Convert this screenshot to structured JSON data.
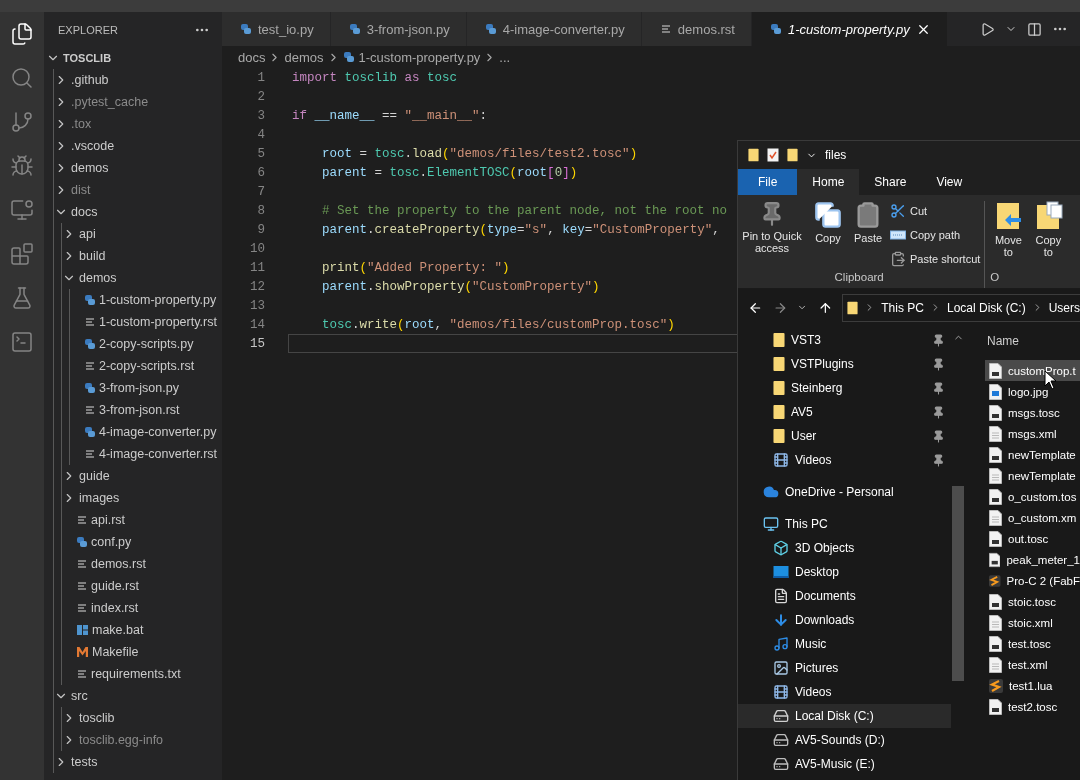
{
  "activity_bar": [
    {
      "kind": "files",
      "selected": true
    },
    {
      "kind": "search",
      "selected": false
    },
    {
      "kind": "source-control",
      "selected": false
    },
    {
      "kind": "debug",
      "selected": false
    },
    {
      "kind": "remote",
      "selected": false
    },
    {
      "kind": "extensions",
      "selected": false
    },
    {
      "kind": "testing",
      "selected": false
    },
    {
      "kind": "terminal",
      "selected": false
    }
  ],
  "sidebar": {
    "title": "EXPLORER",
    "root": {
      "label": "TOSCLIB",
      "kind": "folder",
      "expanded": true,
      "children": [
        {
          "label": ".github",
          "kind": "folder",
          "expanded": false,
          "dimmed": false
        },
        {
          "label": ".pytest_cache",
          "kind": "folder",
          "expanded": false,
          "dimmed": true
        },
        {
          "label": ".tox",
          "kind": "folder",
          "expanded": false,
          "dimmed": true
        },
        {
          "label": ".vscode",
          "kind": "folder",
          "expanded": false,
          "dimmed": false
        },
        {
          "label": "demos",
          "kind": "folder",
          "expanded": false,
          "dimmed": false
        },
        {
          "label": "dist",
          "kind": "folder",
          "expanded": false,
          "dimmed": true
        },
        {
          "label": "docs",
          "kind": "folder",
          "expanded": true,
          "dimmed": false,
          "children": [
            {
              "label": "api",
              "kind": "folder",
              "expanded": false,
              "dimmed": false
            },
            {
              "label": "build",
              "kind": "folder",
              "expanded": false,
              "dimmed": false
            },
            {
              "label": "demos",
              "kind": "folder",
              "expanded": true,
              "dimmed": false,
              "children": [
                {
                  "label": "1-custom-property.py",
                  "kind": "py",
                  "dimmed": false
                },
                {
                  "label": "1-custom-property.rst",
                  "kind": "rst",
                  "dimmed": false
                },
                {
                  "label": "2-copy-scripts.py",
                  "kind": "py",
                  "dimmed": false
                },
                {
                  "label": "2-copy-scripts.rst",
                  "kind": "rst",
                  "dimmed": false
                },
                {
                  "label": "3-from-json.py",
                  "kind": "py",
                  "dimmed": false
                },
                {
                  "label": "3-from-json.rst",
                  "kind": "rst",
                  "dimmed": false
                },
                {
                  "label": "4-image-converter.py",
                  "kind": "py",
                  "dimmed": false
                },
                {
                  "label": "4-image-converter.rst",
                  "kind": "rst",
                  "dimmed": false
                }
              ]
            },
            {
              "label": "guide",
              "kind": "folder",
              "expanded": false,
              "dimmed": false
            },
            {
              "label": "images",
              "kind": "folder",
              "expanded": false,
              "dimmed": false
            },
            {
              "label": "api.rst",
              "kind": "rst",
              "dimmed": false
            },
            {
              "label": "conf.py",
              "kind": "py",
              "dimmed": false
            },
            {
              "label": "demos.rst",
              "kind": "rst",
              "dimmed": false
            },
            {
              "label": "guide.rst",
              "kind": "rst",
              "dimmed": false
            },
            {
              "label": "index.rst",
              "kind": "rst",
              "dimmed": false
            },
            {
              "label": "make.bat",
              "kind": "bat",
              "dimmed": false
            },
            {
              "label": "Makefile",
              "kind": "make",
              "dimmed": false
            },
            {
              "label": "requirements.txt",
              "kind": "rst",
              "dimmed": false
            }
          ]
        },
        {
          "label": "src",
          "kind": "folder",
          "expanded": true,
          "dimmed": false,
          "children": [
            {
              "label": "tosclib",
              "kind": "folder",
              "expanded": false,
              "dimmed": false
            },
            {
              "label": "tosclib.egg-info",
              "kind": "folder",
              "expanded": false,
              "dimmed": true
            }
          ]
        },
        {
          "label": "tests",
          "kind": "folder",
          "expanded": false,
          "dimmed": false
        }
      ]
    }
  },
  "tabs": [
    {
      "label": "test_io.py",
      "kind": "py",
      "selected": false,
      "preview": false
    },
    {
      "label": "3-from-json.py",
      "kind": "py",
      "selected": false,
      "preview": false
    },
    {
      "label": "4-image-converter.py",
      "kind": "py",
      "selected": false,
      "preview": false
    },
    {
      "label": "demos.rst",
      "kind": "rst",
      "selected": false,
      "preview": false
    },
    {
      "label": "1-custom-property.py",
      "kind": "py",
      "selected": true,
      "preview": true
    }
  ],
  "breadcrumb": [
    {
      "label": "docs",
      "kind": "folder"
    },
    {
      "label": "demos",
      "kind": "folder"
    },
    {
      "label": "1-custom-property.py",
      "kind": "py"
    },
    {
      "label": "...",
      "kind": "more"
    }
  ],
  "code": {
    "lines": [
      {
        "number": "1",
        "active": false,
        "indented": false,
        "tokens": [
          {
            "kind": "kw",
            "text": "import"
          },
          {
            "kind": "mod",
            "text": " tosclib"
          },
          {
            "kind": "kw",
            "text": " as"
          },
          {
            "kind": "mod",
            "text": " tosc"
          }
        ]
      },
      {
        "number": "2",
        "active": false
      },
      {
        "number": "3",
        "active": false,
        "indented": false,
        "tokens": [
          {
            "kind": "kw",
            "text": "if"
          },
          {
            "kind": "var",
            "text": " __name__"
          },
          {
            "kind": "plain",
            "text": " == "
          },
          {
            "kind": "str",
            "text": "\"__main__\""
          },
          {
            "kind": "plain",
            "text": ":"
          }
        ]
      },
      {
        "number": "4",
        "active": false
      },
      {
        "number": "5",
        "active": false,
        "indented": true,
        "tokens": [
          {
            "kind": "var",
            "text": "root"
          },
          {
            "kind": "plain",
            "text": " = "
          },
          {
            "kind": "mod",
            "text": "tosc"
          },
          {
            "kind": "plain",
            "text": "."
          },
          {
            "kind": "fn",
            "text": "load"
          },
          {
            "kind": "br1",
            "text": "("
          },
          {
            "kind": "str",
            "text": "\"demos/files/test2.tosc\""
          },
          {
            "kind": "br1",
            "text": ")"
          }
        ]
      },
      {
        "number": "6",
        "active": false,
        "indented": true,
        "tokens": [
          {
            "kind": "var",
            "text": "parent"
          },
          {
            "kind": "plain",
            "text": " = "
          },
          {
            "kind": "mod",
            "text": "tosc"
          },
          {
            "kind": "plain",
            "text": "."
          },
          {
            "kind": "mod",
            "text": "ElementTOSC"
          },
          {
            "kind": "br1",
            "text": "("
          },
          {
            "kind": "var",
            "text": "root"
          },
          {
            "kind": "br2",
            "text": "["
          },
          {
            "kind": "num",
            "text": "0"
          },
          {
            "kind": "br2",
            "text": "]"
          },
          {
            "kind": "br1",
            "text": ")"
          }
        ]
      },
      {
        "number": "7",
        "active": false
      },
      {
        "number": "8",
        "active": false,
        "indented": true,
        "tokens": [
          {
            "kind": "comment",
            "text": "# Set the property to the parent node, not the root no"
          }
        ]
      },
      {
        "number": "9",
        "active": false,
        "indented": true,
        "tokens": [
          {
            "kind": "var",
            "text": "parent"
          },
          {
            "kind": "plain",
            "text": "."
          },
          {
            "kind": "fn",
            "text": "createProperty"
          },
          {
            "kind": "br1",
            "text": "("
          },
          {
            "kind": "var",
            "text": "type"
          },
          {
            "kind": "plain",
            "text": "="
          },
          {
            "kind": "str",
            "text": "\"s\""
          },
          {
            "kind": "plain",
            "text": ", "
          },
          {
            "kind": "var",
            "text": "key"
          },
          {
            "kind": "plain",
            "text": "="
          },
          {
            "kind": "str",
            "text": "\"CustomProperty\""
          },
          {
            "kind": "plain",
            "text": ","
          }
        ]
      },
      {
        "number": "10",
        "active": false
      },
      {
        "number": "11",
        "active": false,
        "indented": true,
        "tokens": [
          {
            "kind": "fn",
            "text": "print"
          },
          {
            "kind": "br1",
            "text": "("
          },
          {
            "kind": "str",
            "text": "\"Added Property: \""
          },
          {
            "kind": "br1",
            "text": ")"
          }
        ]
      },
      {
        "number": "12",
        "active": false,
        "indented": true,
        "tokens": [
          {
            "kind": "var",
            "text": "parent"
          },
          {
            "kind": "plain",
            "text": "."
          },
          {
            "kind": "fn",
            "text": "showProperty"
          },
          {
            "kind": "br1",
            "text": "("
          },
          {
            "kind": "str",
            "text": "\"CustomProperty\""
          },
          {
            "kind": "br1",
            "text": ")"
          }
        ]
      },
      {
        "number": "13",
        "active": false
      },
      {
        "number": "14",
        "active": false,
        "indented": true,
        "tokens": [
          {
            "kind": "mod",
            "text": "tosc"
          },
          {
            "kind": "plain",
            "text": "."
          },
          {
            "kind": "fn",
            "text": "write"
          },
          {
            "kind": "br1",
            "text": "("
          },
          {
            "kind": "var",
            "text": "root"
          },
          {
            "kind": "plain",
            "text": ", "
          },
          {
            "kind": "str",
            "text": "\"demos/files/customProp.tosc\""
          },
          {
            "kind": "br1",
            "text": ")"
          }
        ]
      },
      {
        "number": "15",
        "active": true
      }
    ]
  },
  "file_explorer": {
    "title": "files",
    "ribbon_tabs": [
      {
        "label": "File",
        "kind": "file",
        "selected": false
      },
      {
        "label": "Home",
        "kind": "tab",
        "selected": true
      },
      {
        "label": "Share",
        "kind": "tab",
        "selected": false
      },
      {
        "label": "View",
        "kind": "tab",
        "selected": false
      }
    ],
    "clipboard": {
      "large": [
        {
          "label": "Pin to Quick access",
          "kind": "pin"
        },
        {
          "label": "Copy",
          "kind": "copy"
        },
        {
          "label": "Paste",
          "kind": "paste"
        }
      ],
      "small": [
        {
          "label": "Cut",
          "kind": "cut"
        },
        {
          "label": "Copy path",
          "kind": "path"
        },
        {
          "label": "Paste shortcut",
          "kind": "shortcut"
        }
      ],
      "group": "Clipboard"
    },
    "organize": {
      "large": [
        {
          "label": "Move to",
          "kind": "move"
        },
        {
          "label": "Copy to",
          "kind": "copyto"
        }
      ],
      "group": "O"
    },
    "address": [
      "This PC",
      "Local Disk (C:)",
      "Users"
    ],
    "nav": [
      {
        "label": "VST3",
        "kind": "folder",
        "pinned": true,
        "selected": false
      },
      {
        "label": "VSTPlugins",
        "kind": "folder",
        "pinned": true,
        "selected": false
      },
      {
        "label": "Steinberg",
        "kind": "folder",
        "pinned": true,
        "selected": false
      },
      {
        "label": "AV5",
        "kind": "folder",
        "pinned": true,
        "selected": false
      },
      {
        "label": "User",
        "kind": "folder",
        "pinned": true,
        "selected": false
      },
      {
        "label": "Videos",
        "kind": "videos",
        "pinned": true,
        "selected": false
      },
      {
        "label": "OneDrive - Personal",
        "kind": "cloud",
        "pinned": false,
        "selected": false
      },
      {
        "label": "This PC",
        "kind": "pc",
        "pinned": false,
        "selected": false,
        "children": [
          {
            "label": "3D Objects",
            "kind": "cube",
            "pinned": false,
            "selected": false
          },
          {
            "label": "Desktop",
            "kind": "desktop",
            "pinned": false,
            "selected": false
          },
          {
            "label": "Documents",
            "kind": "documents",
            "pinned": false,
            "selected": false
          },
          {
            "label": "Downloads",
            "kind": "downloads",
            "pinned": false,
            "selected": false
          },
          {
            "label": "Music",
            "kind": "music",
            "pinned": false,
            "selected": false
          },
          {
            "label": "Pictures",
            "kind": "pictures",
            "pinned": false,
            "selected": false
          },
          {
            "label": "Videos",
            "kind": "videos",
            "pinned": false,
            "selected": false
          },
          {
            "label": "Local Disk (C:)",
            "kind": "system-drive",
            "pinned": false,
            "selected": true
          },
          {
            "label": "AV5-Sounds (D:)",
            "kind": "drive",
            "pinned": false,
            "selected": false
          },
          {
            "label": "AV5-Music (E:)",
            "kind": "drive",
            "pinned": false,
            "selected": false
          }
        ]
      }
    ],
    "column": "Name",
    "files": [
      {
        "label": "customProp.t",
        "kind": "tosc",
        "selected": true
      },
      {
        "label": "logo.jpg",
        "kind": "image",
        "selected": false
      },
      {
        "label": "msgs.tosc",
        "kind": "tosc",
        "selected": false
      },
      {
        "label": "msgs.xml",
        "kind": "text",
        "selected": false
      },
      {
        "label": "newTemplate",
        "kind": "tosc",
        "selected": false
      },
      {
        "label": "newTemplate",
        "kind": "text",
        "selected": false
      },
      {
        "label": "o_custom.tos",
        "kind": "tosc",
        "selected": false
      },
      {
        "label": "o_custom.xm",
        "kind": "text",
        "selected": false
      },
      {
        "label": "out.tosc",
        "kind": "tosc",
        "selected": false
      },
      {
        "label": "peak_meter_1",
        "kind": "tosc",
        "selected": false
      },
      {
        "label": "Pro-C 2 (FabF",
        "kind": "lua",
        "selected": false
      },
      {
        "label": "stoic.tosc",
        "kind": "tosc",
        "selected": false
      },
      {
        "label": "stoic.xml",
        "kind": "text",
        "selected": false
      },
      {
        "label": "test.tosc",
        "kind": "tosc",
        "selected": false
      },
      {
        "label": "test.xml",
        "kind": "text",
        "selected": false
      },
      {
        "label": "test1.lua",
        "kind": "lua",
        "selected": false
      },
      {
        "label": "test2.tosc",
        "kind": "tosc",
        "selected": false
      }
    ]
  }
}
